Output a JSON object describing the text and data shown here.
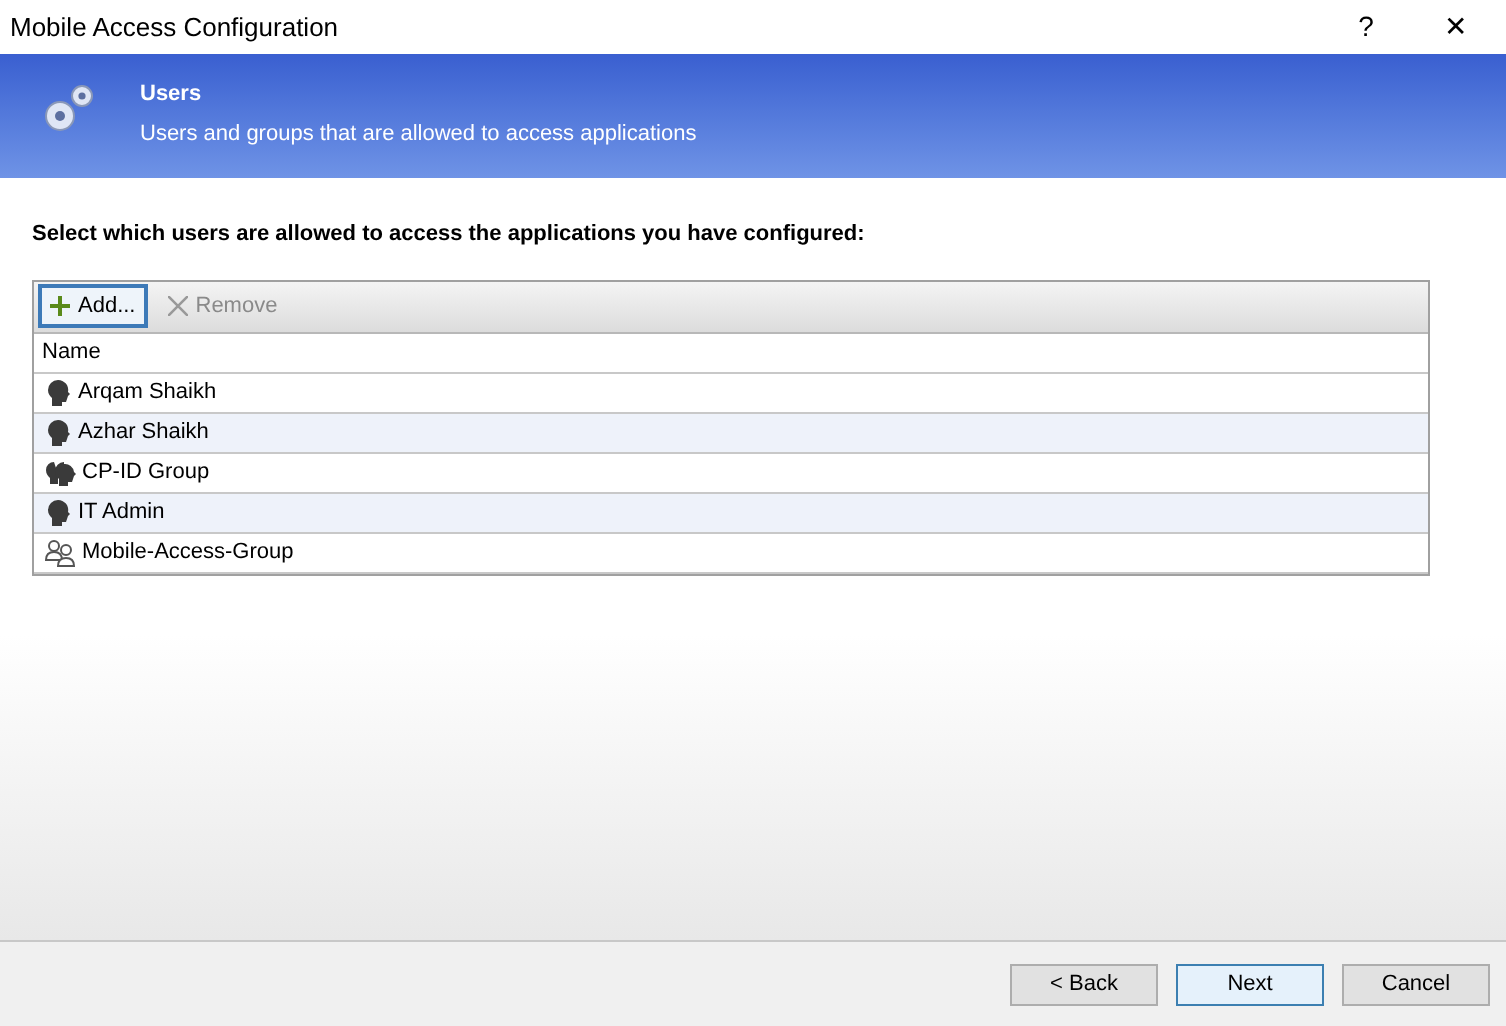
{
  "window": {
    "title": "Mobile Access Configuration",
    "help": "?",
    "close": "✕"
  },
  "banner": {
    "title": "Users",
    "subtitle": "Users and groups that are allowed to access applications"
  },
  "instruction": "Select which users are allowed to access the applications you have configured:",
  "toolbar": [
    {
      "kind": "add",
      "label": "Add...",
      "disabled": false
    },
    {
      "kind": "remove",
      "label": "Remove",
      "disabled": true
    }
  ],
  "table": {
    "columns": [
      "Name"
    ],
    "rows": [
      {
        "kind": "user",
        "name": "Arqam Shaikh"
      },
      {
        "kind": "user",
        "name": "Azhar Shaikh"
      },
      {
        "kind": "group",
        "name": "CP-ID Group"
      },
      {
        "kind": "user",
        "name": "IT Admin"
      },
      {
        "kind": "local-group",
        "name": "Mobile-Access-Group"
      }
    ]
  },
  "buttons": [
    {
      "label": "< Back",
      "default": false
    },
    {
      "label": "Next",
      "default": true
    },
    {
      "label": "Cancel",
      "default": false
    }
  ]
}
